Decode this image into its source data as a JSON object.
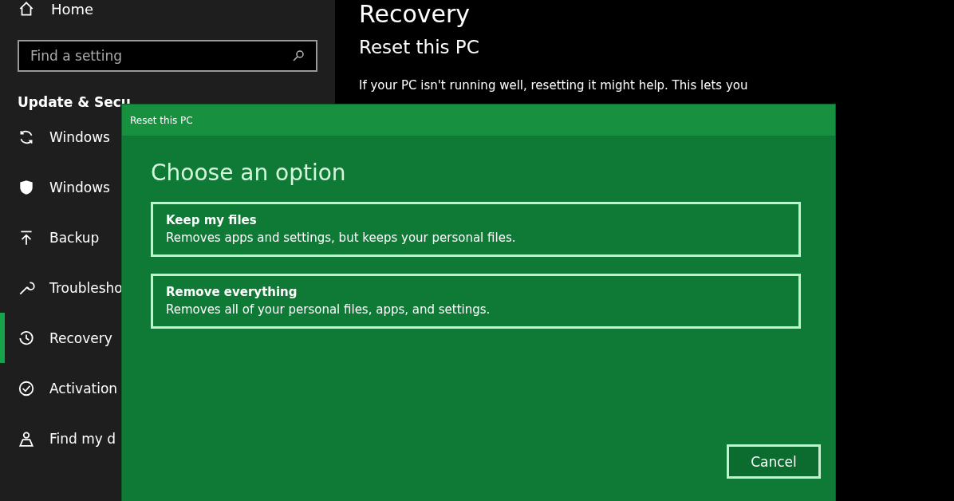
{
  "sidebar": {
    "home": "Home",
    "search": {
      "placeholder": "Find a setting"
    },
    "section_title": "Update & Secu",
    "items": [
      {
        "label": "Windows",
        "selected": false
      },
      {
        "label": "Windows",
        "selected": false
      },
      {
        "label": "Backup",
        "selected": false
      },
      {
        "label": "Troublesho",
        "selected": false
      },
      {
        "label": "Recovery",
        "selected": true
      },
      {
        "label": "Activation",
        "selected": false
      },
      {
        "label": "Find my d",
        "selected": false
      }
    ]
  },
  "content": {
    "title": "Recovery",
    "section": "Reset this PC",
    "description": "If your PC isn't running well, resetting it might help. This lets you"
  },
  "dialog": {
    "title": "Reset this PC",
    "heading": "Choose an option",
    "options": [
      {
        "title": "Keep my files",
        "description": "Removes apps and settings, but keeps your personal files."
      },
      {
        "title": "Remove everything",
        "description": "Removes all of your personal files, apps, and settings."
      }
    ],
    "cancel": "Cancel"
  }
}
